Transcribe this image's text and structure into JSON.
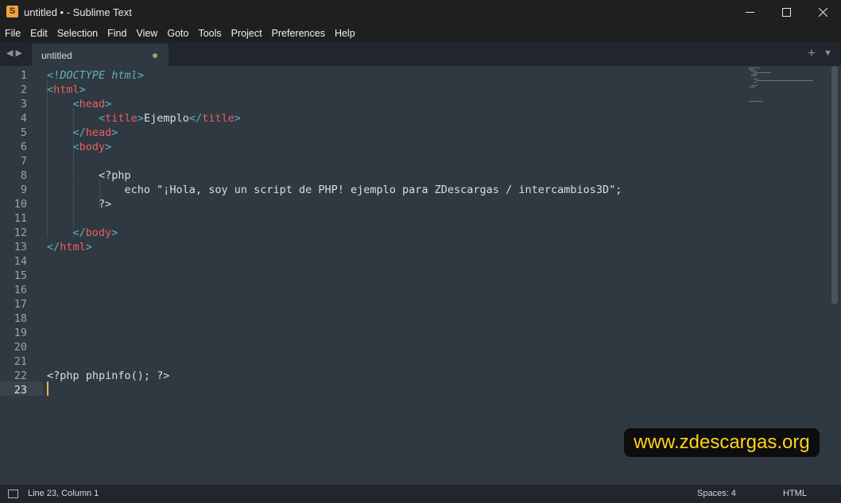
{
  "window": {
    "title": "untitled • - Sublime Text",
    "app_icon": "sublime-s-icon",
    "controls": [
      "minimize",
      "maximize",
      "close"
    ]
  },
  "menu": [
    "File",
    "Edit",
    "Selection",
    "Find",
    "View",
    "Goto",
    "Tools",
    "Project",
    "Preferences",
    "Help"
  ],
  "tab": {
    "name": "untitled",
    "modified_dot_color": "#8bae6d"
  },
  "editor": {
    "line_numbers": [
      "1",
      "2",
      "3",
      "4",
      "5",
      "6",
      "7",
      "8",
      "9",
      "10",
      "11",
      "12",
      "13",
      "14",
      "15",
      "16",
      "17",
      "18",
      "19",
      "20",
      "21",
      "22",
      "23"
    ],
    "current_line": "23",
    "lines": [
      [
        {
          "t": "<!",
          "c": "br"
        },
        {
          "t": "DOCTYPE html",
          "c": "dt"
        },
        {
          "t": ">",
          "c": "br"
        }
      ],
      [
        {
          "t": "<",
          "c": "br"
        },
        {
          "t": "html",
          "c": "tag"
        },
        {
          "t": ">",
          "c": "br"
        }
      ],
      [
        {
          "t": "    ",
          "c": "tx"
        },
        {
          "t": "<",
          "c": "br"
        },
        {
          "t": "head",
          "c": "tag"
        },
        {
          "t": ">",
          "c": "br"
        }
      ],
      [
        {
          "t": "        ",
          "c": "tx"
        },
        {
          "t": "<",
          "c": "br"
        },
        {
          "t": "title",
          "c": "tag"
        },
        {
          "t": ">",
          "c": "br"
        },
        {
          "t": "Ejemplo",
          "c": "tx"
        },
        {
          "t": "</",
          "c": "br"
        },
        {
          "t": "title",
          "c": "tag"
        },
        {
          "t": ">",
          "c": "br"
        }
      ],
      [
        {
          "t": "    ",
          "c": "tx"
        },
        {
          "t": "</",
          "c": "br"
        },
        {
          "t": "head",
          "c": "tag"
        },
        {
          "t": ">",
          "c": "br"
        }
      ],
      [
        {
          "t": "    ",
          "c": "tx"
        },
        {
          "t": "<",
          "c": "br"
        },
        {
          "t": "body",
          "c": "tag"
        },
        {
          "t": ">",
          "c": "br"
        }
      ],
      [],
      [
        {
          "t": "        <?php",
          "c": "tx"
        }
      ],
      [
        {
          "t": "            echo \"¡Hola, soy un script de PHP! ejemplo para ZDescargas / intercambios3D\";",
          "c": "tx"
        }
      ],
      [
        {
          "t": "        ?>",
          "c": "tx"
        }
      ],
      [],
      [
        {
          "t": "    ",
          "c": "tx"
        },
        {
          "t": "</",
          "c": "br"
        },
        {
          "t": "body",
          "c": "tag"
        },
        {
          "t": ">",
          "c": "br"
        }
      ],
      [
        {
          "t": "</",
          "c": "br"
        },
        {
          "t": "html",
          "c": "tag"
        },
        {
          "t": ">",
          "c": "br"
        }
      ],
      [],
      [],
      [],
      [],
      [],
      [],
      [],
      [],
      [
        {
          "t": "<?php phpinfo(); ?>",
          "c": "tx"
        }
      ],
      []
    ]
  },
  "watermark": {
    "text": "www.zdescargas.org"
  },
  "status": {
    "position": "Line 23, Column 1",
    "spaces": "Spaces: 4",
    "syntax": "HTML",
    "panel_icon": "panel-toggle-icon"
  },
  "colors": {
    "background": "#303841",
    "tag": "#ec5f66",
    "bracket": "#5fb4b4",
    "text": "#d8dee9",
    "cursor": "#f9ae58",
    "watermark": "#ffd31a"
  }
}
